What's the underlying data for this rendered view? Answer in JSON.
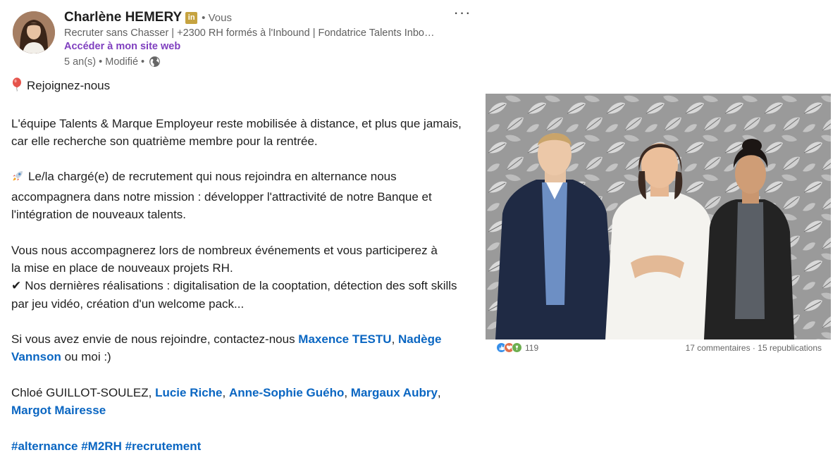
{
  "author": {
    "name": "Charlène HEMERY",
    "badge": "in",
    "you_label": "• Vous",
    "headline": "Recruter sans Chasser | +2300 RH formés à l'Inbound | Fondatrice Talents Inbound",
    "site_link": "Accéder à mon site web",
    "meta": "5 an(s) • Modifié •"
  },
  "more_label": "···",
  "post": {
    "line1": "Rejoignez-nous",
    "para1": "L'équipe Talents & Marque Employeur reste mobilisée à distance, et plus que jamais, car elle recherche son quatrième membre pour la rentrée.",
    "para2_l1": "Le/la chargé(e) de recrutement qui nous rejoindra en alternance nous",
    "para2_rest": "accompagnera dans notre mission : développer l'attractivité de notre Banque et l'intégration de nouveaux talents.",
    "para3_l1": "Vous nous accompagnerez lors de nombreux événements et vous participerez à",
    "para3_l2": "la mise en place de nouveaux projets RH.",
    "para3_l3": "Nos dernières réalisations : digitalisation de la cooptation, détection des soft skills par jeu vidéo, création d'un welcome pack...",
    "check_glyph": "✔",
    "para4_text": "Si vous avez envie de nous rejoindre, contactez-nous ",
    "mention1": "Maxence TESTU",
    "sep1": ", ",
    "mention2": "Nadège Vannson",
    "para4_end": " ou moi :)",
    "tag_plain": "Chloé GUILLOT-SOULEZ, ",
    "tag1": "Lucie Riche",
    "tag_sep": ", ",
    "tag2": "Anne-Sophie Guého",
    "tag3": "Margaux Aubry",
    "tag4": "Margot Mairesse",
    "hashtags": "#alternance #M2RH #recrutement"
  },
  "social": {
    "reaction_count": "119",
    "comments_reposts": "17 commentaires · 15 republications",
    "colors": {
      "like": "#378fe9",
      "celebrate": "#df704d",
      "support": "#6dae4f"
    }
  },
  "icons": {
    "balloon": "balloon-icon",
    "rocket": "rocket-icon",
    "globe": "globe-icon",
    "check": "check-icon"
  }
}
